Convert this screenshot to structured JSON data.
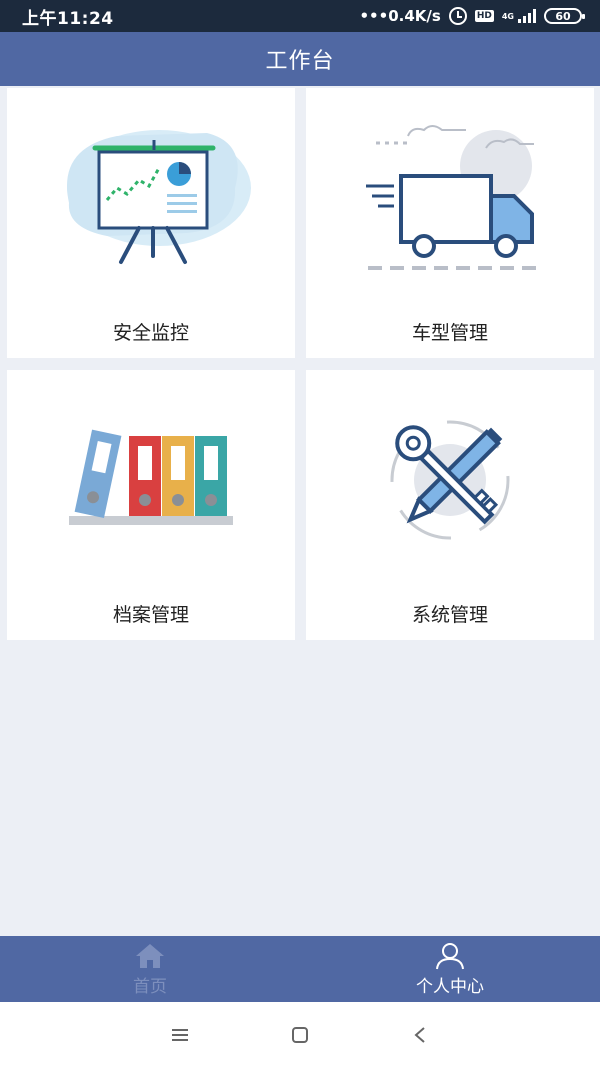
{
  "status_bar": {
    "time": "上午11:24",
    "network_speed": "•••0.4K/s",
    "hd_label": "HD",
    "net_type": "4G",
    "battery": "60"
  },
  "header": {
    "title": "工作台"
  },
  "tiles": [
    {
      "label": "安全监控",
      "icon": "presentation-board-icon"
    },
    {
      "label": "车型管理",
      "icon": "truck-icon"
    },
    {
      "label": "档案管理",
      "icon": "binders-icon"
    },
    {
      "label": "系统管理",
      "icon": "tools-icon"
    }
  ],
  "bottom_nav": {
    "items": [
      {
        "label": "首页",
        "icon": "home-icon",
        "active": false
      },
      {
        "label": "个人中心",
        "icon": "user-icon",
        "active": true
      }
    ]
  },
  "colors": {
    "status_bar": "#1c2a3d",
    "header": "#5068a3",
    "background": "#eceff5",
    "nav_inactive": "#7d8fbd",
    "nav_active": "#ffffff"
  }
}
